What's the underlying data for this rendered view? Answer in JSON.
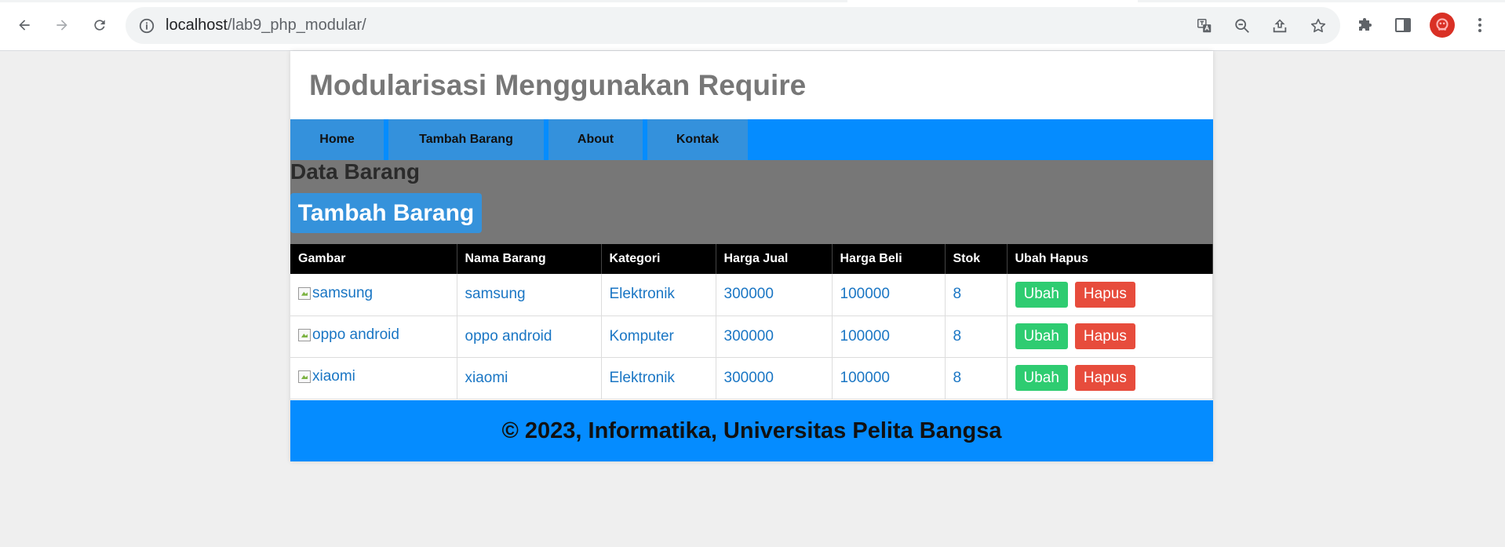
{
  "browser": {
    "url_host": "localhost",
    "url_path": "/lab9_php_modular/"
  },
  "header": {
    "title": "Modularisasi Menggunakan Require"
  },
  "nav": {
    "items": [
      {
        "label": "Home"
      },
      {
        "label": "Tambah Barang"
      },
      {
        "label": "About"
      },
      {
        "label": "Kontak"
      }
    ]
  },
  "content": {
    "heading": "Data Barang",
    "add_button": "Tambah Barang"
  },
  "table": {
    "headers": [
      "Gambar",
      "Nama Barang",
      "Kategori",
      "Harga Jual",
      "Harga Beli",
      "Stok",
      "Ubah Hapus"
    ],
    "rows": [
      {
        "gambar_alt": "samsung",
        "nama": "samsung",
        "kategori": "Elektronik",
        "harga_jual": "300000",
        "harga_beli": "100000",
        "stok": "8"
      },
      {
        "gambar_alt": "oppo android",
        "nama": "oppo android",
        "kategori": "Komputer",
        "harga_jual": "300000",
        "harga_beli": "100000",
        "stok": "8"
      },
      {
        "gambar_alt": "xiaomi",
        "nama": "xiaomi",
        "kategori": "Elektronik",
        "harga_jual": "300000",
        "harga_beli": "100000",
        "stok": "8"
      }
    ],
    "edit_label": "Ubah",
    "delete_label": "Hapus"
  },
  "footer": {
    "text": "© 2023, Informatika, Universitas Pelita Bangsa"
  },
  "colors": {
    "nav_bar": "#058cff",
    "nav_item": "#3491dc",
    "content_bg": "#777777",
    "edit_button": "#2ecc71",
    "delete_button": "#e74c3c"
  },
  "icons": [
    "back-icon",
    "forward-icon",
    "reload-icon",
    "info-icon",
    "translate-icon",
    "zoom-out-icon",
    "share-icon",
    "star-icon",
    "extensions-icon",
    "side-panel-icon",
    "profile-avatar",
    "menu-icon"
  ]
}
